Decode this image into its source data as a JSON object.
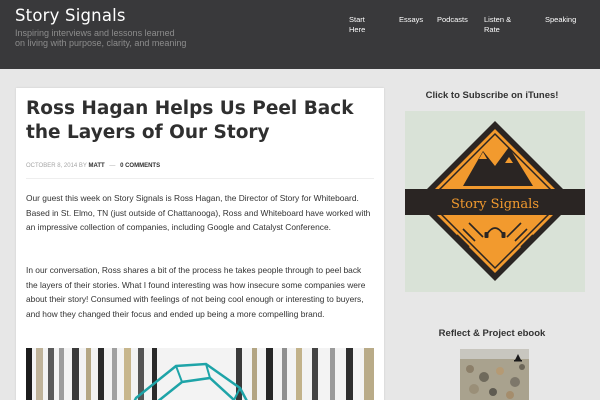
{
  "site": {
    "title": "Story Signals",
    "description": "Inspiring interviews and lessons learned on living with purpose, clarity, and meaning"
  },
  "nav": {
    "items": [
      {
        "label": "Start\nHere"
      },
      {
        "label": "Essays"
      },
      {
        "label": "Podcasts"
      },
      {
        "label": "Listen &\nRate"
      },
      {
        "label": "Speaking"
      }
    ]
  },
  "post": {
    "title": "Ross Hagan Helps Us Peel Back the Layers of Our Story",
    "date": "October 8, 2014",
    "by_label": "by",
    "author": "Matt",
    "separator": "—",
    "comments": "0 Comments",
    "paragraphs": [
      "Our guest this week on Story Signals is Ross Hagan, the Director of Story for Whiteboard. Based in St. Elmo, TN (just outside of Chattanooga), Ross and Whiteboard have worked with an impressive collection of companies, including Google and Catalyst Conference.",
      "In our conversation, Ross shares a bit of the process he takes people through to peel back the layers of their stories. What I found interesting was how insecure some companies were about their story! Consumed with feelings of not being cool enough or interesting to buyers, and how they changed their focus and ended up being a more compelling brand."
    ]
  },
  "sidebar": {
    "itunes_heading": "Click to Subscribe on iTunes!",
    "podcast_logo_text": "Story Signals",
    "ebook_heading": "Reflect & Project ebook"
  },
  "colors": {
    "header_bg": "#39393b",
    "logo_orange": "#f29a2e",
    "logo_dark": "#2a2523",
    "art_bg": "#d9e2d7",
    "teal_accent": "#1ea4a8"
  }
}
